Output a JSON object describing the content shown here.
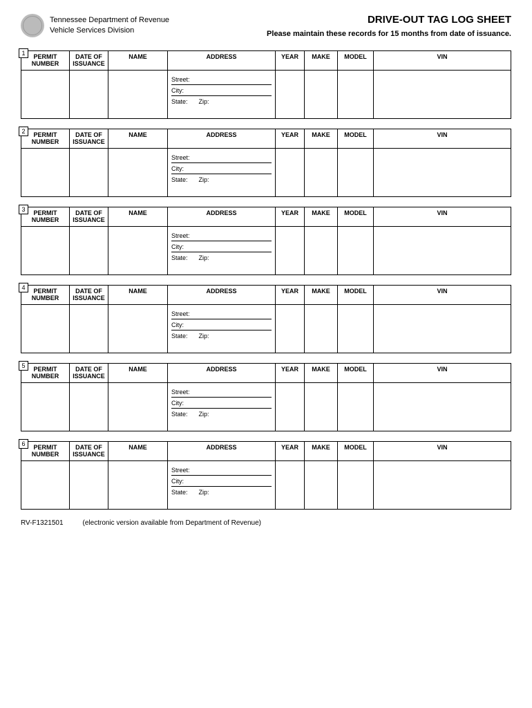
{
  "header": {
    "dept_line1": "Tennessee Department of Revenue",
    "dept_line2": "Vehicle Services Division",
    "title": "DRIVE-OUT TAG LOG SHEET",
    "subtitle": "Please maintain these records for 15 months from date of issuance."
  },
  "columns": {
    "permit": "PERMIT NUMBER",
    "date": "DATE OF ISSUANCE",
    "name": "NAME",
    "address": "ADDRESS",
    "year": "YEAR",
    "make": "MAKE",
    "model": "MODEL",
    "vin": "VIN"
  },
  "addr_labels": {
    "street": "Street:",
    "city": "City:",
    "state": "State:",
    "zip": "Zip:"
  },
  "entries": [
    {
      "num": "1"
    },
    {
      "num": "2"
    },
    {
      "num": "3"
    },
    {
      "num": "4"
    },
    {
      "num": "5"
    },
    {
      "num": "6"
    }
  ],
  "footer": {
    "form_id": "RV-F1321501",
    "note": "(electronic version available from Department of Revenue)"
  }
}
